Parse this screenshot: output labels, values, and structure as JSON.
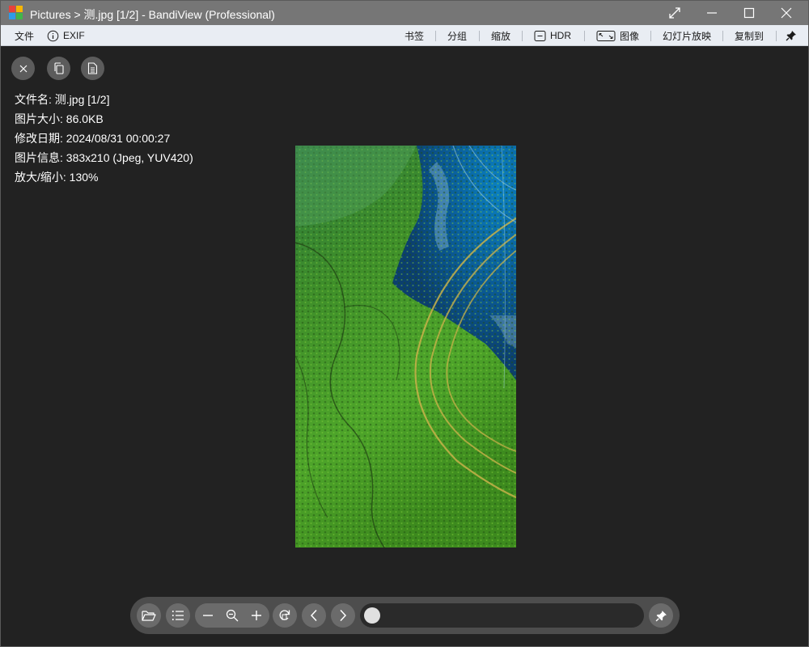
{
  "window": {
    "title": "Pictures > 测.jpg [1/2] - BandiView (Professional)"
  },
  "menu": {
    "file": "文件",
    "exif": "EXIF",
    "bookmark": "书签",
    "group": "分组",
    "zoom": "缩放",
    "hdr": "HDR",
    "image": "图像",
    "slideshow": "幻灯片放映",
    "copy_to": "复制到"
  },
  "info": {
    "filename": "文件名: 测.jpg [1/2]",
    "size": "图片大小: 86.0KB",
    "modified": "修改日期: 2024/08/31 00:00:27",
    "details": "图片信息: 383x210 (Jpeg, YUV420)",
    "zoom": "放大/缩小: 130%"
  },
  "navigator": {
    "position_fraction": 0
  },
  "icons": {
    "title": [
      "app-logo-icon",
      "fullscreen-icon",
      "minimize-icon",
      "maximize-icon",
      "close-icon"
    ],
    "menu": [
      "info-icon",
      "hdr-icon",
      "image-icon",
      "pin-icon"
    ],
    "overlay": [
      "close-icon",
      "copy-icon",
      "document-icon"
    ],
    "toolbar": [
      "folder-open-icon",
      "list-icon",
      "zoom-out-icon",
      "zoom-fit-icon",
      "zoom-in-icon",
      "rotate-icon",
      "previous-icon",
      "next-icon",
      "pin-icon"
    ]
  },
  "colors": {
    "titlebar": "#767676",
    "menubar": "#e9edf3",
    "background": "#222222",
    "toolbar": "#4d4d4d",
    "button": "#6b6b6b",
    "slider_thumb": "#e0e0e0"
  }
}
